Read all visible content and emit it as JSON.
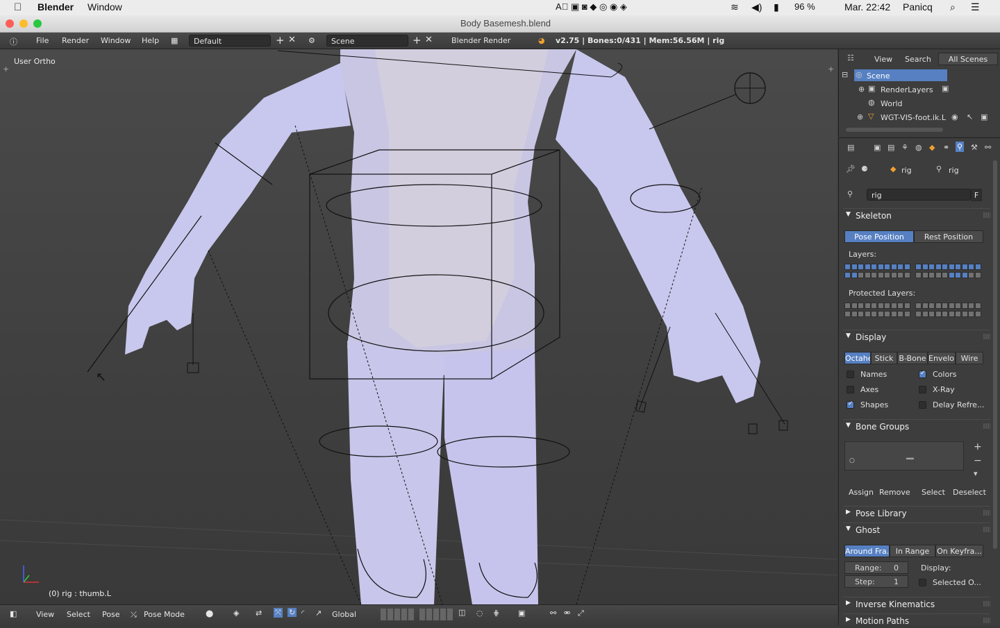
{
  "mac_menubar": {
    "app": "Blender",
    "menu_window": "Window",
    "battery": "96 %",
    "clock": "Mar. 22:42",
    "user": "Panicq"
  },
  "window": {
    "title": "Body Basemesh.blend"
  },
  "info_header": {
    "menu": [
      "File",
      "Render",
      "Window",
      "Help"
    ],
    "layout": "Default",
    "scene": "Scene",
    "engine": "Blender Render",
    "stats": "v2.75 | Bones:0/431 | Mem:56.56M | rig"
  },
  "viewport": {
    "view_label": "User Ortho",
    "object_label": "(0) rig : thumb.L"
  },
  "viewport_footer": {
    "items": [
      "View",
      "Select",
      "Pose"
    ],
    "mode": "Pose Mode",
    "orientation": "Global"
  },
  "outliner": {
    "menu": [
      "View",
      "Search"
    ],
    "filter": "All Scenes",
    "items": [
      "Scene",
      "RenderLayers",
      "World",
      "WGT-VIS-foot.ik.L"
    ]
  },
  "properties": {
    "breadcrumb": [
      "rig",
      "rig"
    ],
    "datablock": "rig",
    "datablock_fake": "F",
    "skeleton": {
      "title": "Skeleton",
      "pose_position": "Pose Position",
      "rest_position": "Rest Position",
      "layers_label": "Layers:",
      "protected_label": "Protected Layers:"
    },
    "display": {
      "title": "Display",
      "modes": [
        "Octahe",
        "Stick",
        "B-Bone",
        "Envelop",
        "Wire"
      ],
      "names": "Names",
      "colors": "Colors",
      "axes": "Axes",
      "xray": "X-Ray",
      "shapes": "Shapes",
      "delay": "Delay Refre..."
    },
    "bone_groups": {
      "title": "Bone Groups",
      "assign": "Assign",
      "remove": "Remove",
      "select": "Select",
      "deselect": "Deselect"
    },
    "pose_library": {
      "title": "Pose Library"
    },
    "ghost": {
      "title": "Ghost",
      "modes": [
        "Around Fra...",
        "In Range",
        "On Keyfra..."
      ],
      "range_label": "Range:",
      "range_value": "0",
      "step_label": "Step:",
      "step_value": "1",
      "display_label": "Display:",
      "selected_only": "Selected O..."
    },
    "inverse_kinematics": {
      "title": "Inverse Kinematics"
    },
    "motion_paths": {
      "title": "Motion Paths"
    }
  },
  "colors": {
    "accent": "#5680c2",
    "panel": "#3d3d3d",
    "viewport": "#404040"
  }
}
